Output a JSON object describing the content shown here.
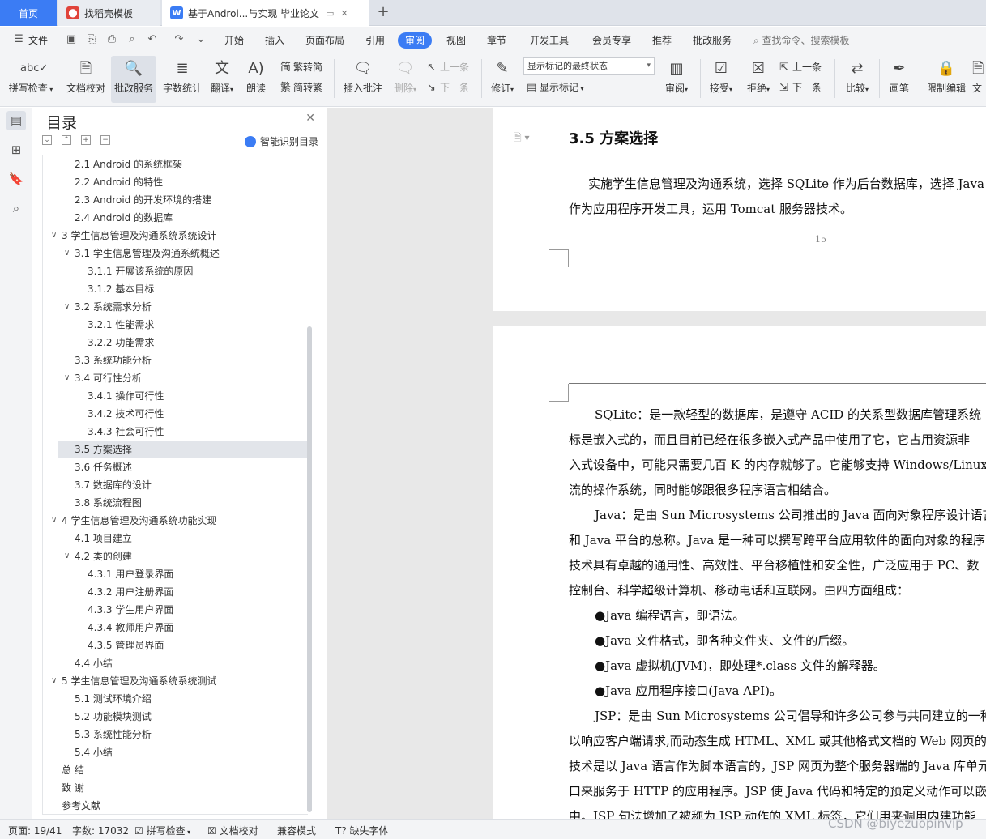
{
  "tabs": {
    "home": "首页",
    "template": "找稻壳模板",
    "doc": "基于Androi...与实现 毕业论文"
  },
  "menu": {
    "file": "文件",
    "items": [
      "开始",
      "插入",
      "页面布局",
      "引用",
      "审阅",
      "视图",
      "章节",
      "开发工具",
      "会员专享",
      "推荐",
      "批改服务"
    ],
    "active": "审阅",
    "search": "查找命令、搜索模板"
  },
  "ribbon": {
    "spell": "拼写检查",
    "doccheck": "文档校对",
    "review_service": "批改服务",
    "wordcount": "字数统计",
    "translate": "翻译",
    "read": "朗读",
    "to_simplified": "繁转简",
    "to_traditional": "简转繁",
    "insert_comment": "插入批注",
    "delete": "删除",
    "prev": "上一条",
    "next": "下一条",
    "revise": "修订",
    "markup_select": "显示标记的最终状态",
    "show_markup": "显示标记",
    "review": "审阅",
    "accept": "接受",
    "reject": "拒绝",
    "prev2": "上一条",
    "next2": "下一条",
    "compare": "比较",
    "pen": "画笔",
    "restrict": "限制编辑",
    "doc_more": "文"
  },
  "toc": {
    "title": "目录",
    "smart": "智能识别目录",
    "items": [
      "2.1 Android 的系统框架",
      "2.2 Android 的特性",
      "2.3 Android 的开发环境的搭建",
      "2.4 Android 的数据库",
      "3  学生信息管理及沟通系统系统设计",
      "3.1  学生信息管理及沟通系统概述",
      "3.1.1 开展该系统的原因",
      "3.1.2  基本目标",
      "3.2  系统需求分析",
      "3.2.1  性能需求",
      "3.2.2  功能需求",
      "3.3  系统功能分析",
      "3.4  可行性分析",
      "3.4.1 操作可行性",
      "3.4.2 技术可行性",
      "3.4.3 社会可行性",
      "3.5  方案选择",
      "3.6  任务概述",
      "3.7  数据库的设计",
      "3.8  系统流程图",
      "4  学生信息管理及沟通系统功能实现",
      "4.1  项目建立",
      "4.2  类的创建",
      "4.3.1  用户登录界面",
      "4.3.2  用户注册界面",
      "4.3.3  学生用户界面",
      "4.3.4  教师用户界面",
      "4.3.5  管理员界面",
      "4.4  小结",
      "5  学生信息管理及沟通系统系统测试",
      "5.1  测试环境介绍",
      "5.2  功能模块测试",
      "5.3  系统性能分析",
      "5.4  小结",
      "总    结",
      "致    谢",
      "参考文献"
    ]
  },
  "doc": {
    "heading": "3.5  方案选择",
    "p1_l1": "实施学生信息管理及沟通系统，选择 SQLite 作为后台数据库，选择 Java",
    "p1_l2": "作为应用程序开发工具，运用 Tomcat 服务器技术。",
    "page_num": "15",
    "lines": [
      "SQLite：是一款轻型的数据库，是遵守 ACID 的关系型数据库管理系统",
      "标是嵌入式的，而且目前已经在很多嵌入式产品中使用了它，它占用资源非",
      "入式设备中，可能只需要几百 K 的内存就够了。它能够支持 Windows/Linux",
      "流的操作系统，同时能够跟很多程序语言相结合。",
      "Java：是由 Sun Microsystems 公司推出的 Java 面向对象程序设计语言（",
      "和 Java 平台的总称。Java 是一种可以撰写跨平台应用软件的面向对象的程序",
      "技术具有卓越的通用性、高效性、平台移植性和安全性，广泛应用于 PC、数",
      "控制台、科学超级计算机、移动电话和互联网。由四方面组成：",
      "●Java 编程语言，即语法。",
      "●Java 文件格式，即各种文件夹、文件的后缀。",
      "●Java 虚拟机(JVM)，即处理*.class 文件的解释器。",
      "●Java 应用程序接口(Java API)。",
      "JSP：是由 Sun Microsystems 公司倡导和许多公司参与共同建立的一种使",
      "以响应客户端请求,而动态生成 HTML、XML 或其他格式文档的 Web 网页的",
      "技术是以 Java 语言作为脚本语言的，JSP 网页为整个服务器端的 Java 库单元",
      "口来服务于 HTTP 的应用程序。JSP 使 Java 代码和特定的预定义动作可以嵌",
      "中。JSP 句法增加了被称为 JSP 动作的 XML 标签，它们用来调用内建功能"
    ]
  },
  "status": {
    "page": "页面: 19/41",
    "words": "字数: 17032",
    "spell": "拼写检查",
    "doccheck": "文档校对",
    "compat": "兼容模式",
    "missing_font": "缺失字体"
  },
  "watermark": "CSDN @biyezuopinvip",
  "colors": {
    "accent": "#3b7cf4",
    "chrome": "#f3f4f6",
    "tabbar": "#dfe3ea"
  }
}
